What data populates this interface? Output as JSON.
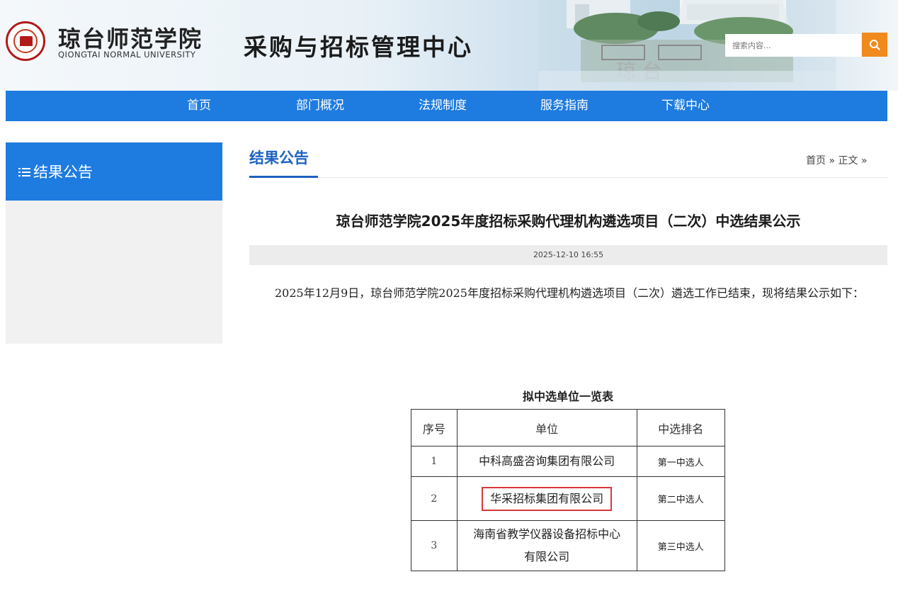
{
  "header": {
    "logo_cn": "琼台师范学院",
    "logo_en": "QIONGTAI NORMAL UNIVERSITY",
    "site_title": "采购与招标管理中心",
    "search_placeholder": "搜索内容..."
  },
  "nav": [
    "首页",
    "部门概况",
    "法规制度",
    "服务指南",
    "下载中心"
  ],
  "sidebar": {
    "title": "结果公告"
  },
  "main": {
    "section_title": "结果公告",
    "breadcrumb": {
      "home": "首页",
      "sep1": "»",
      "current": "正文",
      "sep2": "»"
    },
    "article_title": "琼台师范学院2025年度招标采购代理机构遴选项目（二次）中选结果公示",
    "date": "2025-12-10 16:55",
    "paragraph": "2025年12月9日，琼台师范学院2025年度招标采购代理机构遴选项目（二次）遴选工作已结束，现将结果公示如下："
  },
  "table": {
    "caption": "拟中选单位一览表",
    "headers": [
      "序号",
      "单位",
      "中选排名"
    ],
    "rows": [
      {
        "no": "1",
        "unit": "中科高盛咨询集团有限公司",
        "rank": "第一中选人"
      },
      {
        "no": "2",
        "unit": "华采招标集团有限公司",
        "rank": "第二中选人"
      },
      {
        "no": "3",
        "unit": "海南省教学仪器设备招标中心有限公司",
        "unit_line1": "海南省教学仪器设备招标中心",
        "unit_line2": "有限公司",
        "rank": "第三中选人"
      }
    ]
  },
  "colors": {
    "primary": "#1e7be0",
    "title_blue": "#1e62c0",
    "search_btn": "#f08a1c",
    "highlight": "#d9363e"
  },
  "icons": {
    "logo": "university-emblem-icon",
    "search": "search-icon",
    "list": "list-icon"
  }
}
